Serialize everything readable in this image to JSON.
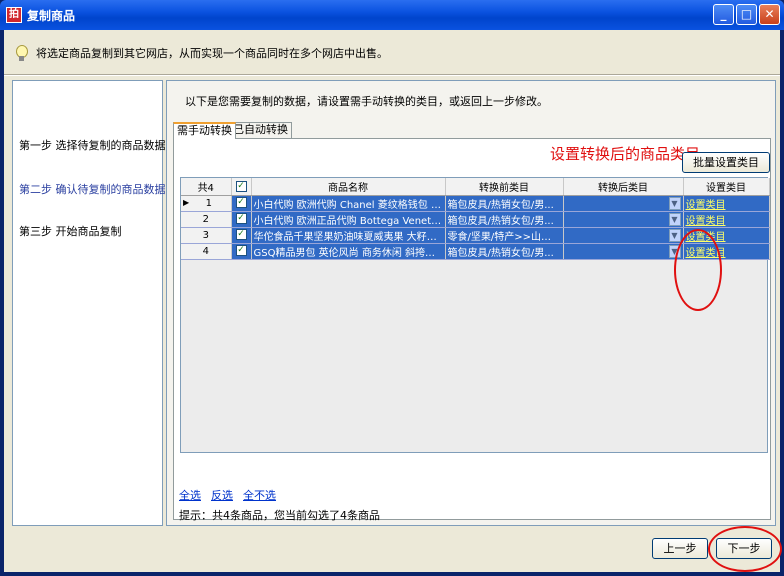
{
  "window": {
    "title": "复制商品",
    "app_icon_label": "拍"
  },
  "hint": "将选定商品复制到其它网店，从而实现一个商品同时在多个网店中出售。",
  "steps": [
    {
      "label": "第一步  选择待复制的商品数据"
    },
    {
      "label": "第二步  确认待复制的商品数据"
    },
    {
      "label": "第三步  开始商品复制"
    }
  ],
  "main": {
    "description": "以下是您需要复制的数据，请设置需手动转换的类目，或返回上一步修改。",
    "tabs": [
      "需手动转换",
      "已自动转换"
    ],
    "annotation": "设置转换后的商品类目",
    "batch_button": "批量设置类目"
  },
  "table": {
    "count_header": "共4",
    "columns": [
      "商品名称",
      "转换前类目",
      "转换后类目",
      "设置类目"
    ],
    "rows": [
      {
        "idx": "1",
        "name": "小白代购 欧洲代购 Chanel 菱纹格钱包 A...",
        "before": "箱包皮具/热销女包/男...",
        "after": "",
        "action": "设置类目"
      },
      {
        "idx": "2",
        "name": "小白代购 欧洲正品代购 Bottega Veneta ...",
        "before": "箱包皮具/热销女包/男...",
        "after": "",
        "action": "设置类目"
      },
      {
        "idx": "3",
        "name": "华佗食品千果坚果奶油味夏威夷果 大籽20...",
        "before": "零食/坚果/特产>>山核...",
        "after": "",
        "action": "设置类目"
      },
      {
        "idx": "4",
        "name": "GSQ精品男包 英伦风尚 商务休闲 斜挎包 ...",
        "before": "箱包皮具/热销女包/男...",
        "after": "",
        "action": "设置类目"
      }
    ]
  },
  "selection_links": [
    "全选",
    "反选",
    "全不选"
  ],
  "summary": "提示：共4条商品，您当前勾选了4条商品",
  "buttons": {
    "prev": "上一步",
    "next": "下一步"
  }
}
